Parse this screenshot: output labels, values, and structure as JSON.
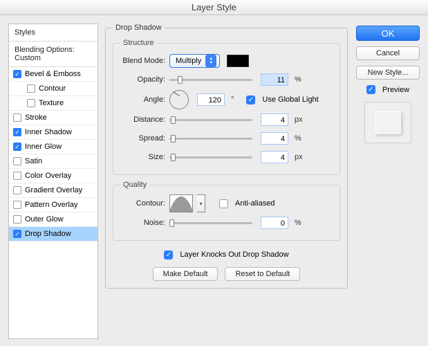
{
  "window": {
    "title": "Layer Style"
  },
  "sidebar": {
    "styles_heading": "Styles",
    "blending_heading": "Blending Options: Custom",
    "items": [
      {
        "label": "Bevel & Emboss",
        "checked": true,
        "indent": false,
        "selected": false
      },
      {
        "label": "Contour",
        "checked": false,
        "indent": true,
        "selected": false
      },
      {
        "label": "Texture",
        "checked": false,
        "indent": true,
        "selected": false
      },
      {
        "label": "Stroke",
        "checked": false,
        "indent": false,
        "selected": false
      },
      {
        "label": "Inner Shadow",
        "checked": true,
        "indent": false,
        "selected": false
      },
      {
        "label": "Inner Glow",
        "checked": true,
        "indent": false,
        "selected": false
      },
      {
        "label": "Satin",
        "checked": false,
        "indent": false,
        "selected": false
      },
      {
        "label": "Color Overlay",
        "checked": false,
        "indent": false,
        "selected": false
      },
      {
        "label": "Gradient Overlay",
        "checked": false,
        "indent": false,
        "selected": false
      },
      {
        "label": "Pattern Overlay",
        "checked": false,
        "indent": false,
        "selected": false
      },
      {
        "label": "Outer Glow",
        "checked": false,
        "indent": false,
        "selected": false
      },
      {
        "label": "Drop Shadow",
        "checked": true,
        "indent": false,
        "selected": true
      }
    ]
  },
  "main": {
    "group_title": "Drop Shadow",
    "structure": {
      "title": "Structure",
      "blend_mode_label": "Blend Mode:",
      "blend_mode_value": "Multiply",
      "shadow_color": "#000000",
      "opacity_label": "Opacity:",
      "opacity_value": "11",
      "opacity_unit": "%",
      "angle_label": "Angle:",
      "angle_value": "120",
      "angle_unit": "°",
      "global_light_checked": true,
      "global_light_label": "Use Global Light",
      "distance_label": "Distance:",
      "distance_value": "4",
      "distance_unit": "px",
      "spread_label": "Spread:",
      "spread_value": "4",
      "spread_unit": "%",
      "size_label": "Size:",
      "size_value": "4",
      "size_unit": "px"
    },
    "quality": {
      "title": "Quality",
      "contour_label": "Contour:",
      "anti_aliased_checked": false,
      "anti_aliased_label": "Anti-aliased",
      "noise_label": "Noise:",
      "noise_value": "0",
      "noise_unit": "%"
    },
    "knocks_out_checked": true,
    "knocks_out_label": "Layer Knocks Out Drop Shadow",
    "make_default_label": "Make Default",
    "reset_default_label": "Reset to Default"
  },
  "right": {
    "ok": "OK",
    "cancel": "Cancel",
    "new_style": "New Style...",
    "preview_checked": true,
    "preview_label": "Preview"
  }
}
